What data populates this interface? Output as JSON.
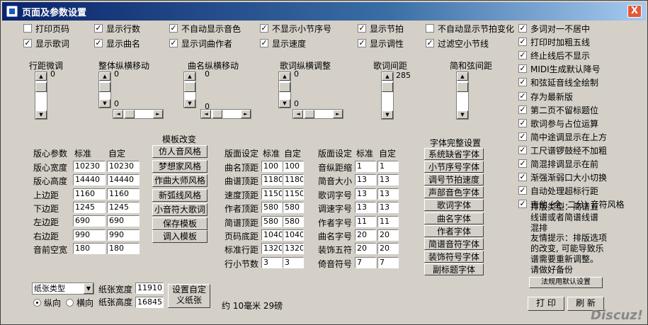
{
  "window": {
    "title": "页面及参数设置",
    "close": "X"
  },
  "row1": [
    "打印页码",
    "显示行数",
    "不自动显示音色",
    "不显示小节序号",
    "显示节拍",
    "不自动显示节拍变化"
  ],
  "row1_checked": [
    false,
    true,
    true,
    true,
    true,
    false
  ],
  "row2": [
    "显示歌词",
    "显示曲名",
    "显示词曲作者",
    "显示速度",
    "显示调性",
    "过滤空小节线"
  ],
  "row2_checked": [
    true,
    true,
    true,
    true,
    true,
    true
  ],
  "right_options": [
    "多词对一不居中",
    "打印时加粗五线",
    "终止线后不显示",
    "MIDI生成默认降号",
    "和弦延音线全绘制",
    "存为最新版",
    "第二页不留标题位",
    "歌词参与占位运算",
    "简中途调显示在上方",
    "工尺谱锣鼓经不加粗",
    "简混排调显示在前",
    "渐强渐弱口大小切换",
    "自动处理超标行距",
    "吉他 (全, 二分) 音符风格"
  ],
  "right_checked": [
    true,
    true,
    true,
    true,
    true,
    true,
    true,
    true,
    true,
    true,
    true,
    true,
    true,
    true
  ],
  "sliders": {
    "line_spacing": "行距微调",
    "overall": "整体纵横移动",
    "title_move": "曲名纵横移动",
    "lyric_adjust": "歌词纵横调整",
    "lyric_spacing": "歌词间距",
    "chord_spacing": "简和弦间距"
  },
  "slider_vals": {
    "v1": "0",
    "v2a": "0",
    "v2b": "0",
    "v3a": "0",
    "v3b": "0",
    "v4a": "0",
    "v4b": "0",
    "v5": "285"
  },
  "layout_table": {
    "header": [
      "版心参数",
      "标准",
      "自定"
    ],
    "rows": [
      [
        "版心宽度",
        "10230",
        "10230"
      ],
      [
        "版心高度",
        "14440",
        "14440"
      ],
      [
        "上边距",
        "1160",
        "1160"
      ],
      [
        "下边距",
        "1245",
        "1245"
      ],
      [
        "左边距",
        "690",
        "690"
      ],
      [
        "右边距",
        "990",
        "990"
      ],
      [
        "音前空宽",
        "180",
        "180"
      ]
    ]
  },
  "templates": {
    "title": "模板改变",
    "buttons": [
      "仿人音风格",
      "梦想家风格",
      "作曲大师风格",
      "新弧线风格",
      "小音符大歌词",
      "保存模板",
      "调入模板"
    ]
  },
  "page_table": {
    "header": [
      "版面设定",
      "标准",
      "自定"
    ],
    "rows": [
      [
        "曲名顶距",
        "100",
        "100"
      ],
      [
        "曲谱顶距",
        "1180",
        "1180"
      ],
      [
        "速度顶距",
        "1150",
        "1150"
      ],
      [
        "作者顶距",
        "580",
        "580"
      ],
      [
        "简谱顶距",
        "580",
        "580"
      ],
      [
        "页码底距",
        "1040",
        "1040"
      ],
      [
        "标准行距",
        "1320",
        "1320"
      ],
      [
        "行小节数",
        "3",
        "3"
      ]
    ]
  },
  "page_table2": {
    "header": [
      "版面设定",
      "标准",
      "自定"
    ],
    "rows": [
      [
        "音纵距缩",
        "1",
        "1"
      ],
      [
        "简音大小",
        "13",
        "13"
      ],
      [
        "歌词字号",
        "13",
        "13"
      ],
      [
        "调速字号",
        "13",
        "13"
      ],
      [
        "作者字号",
        "11",
        "11"
      ],
      [
        "曲名字号",
        "20",
        "20"
      ],
      [
        "装饰五符",
        "20",
        "20"
      ],
      [
        "倚音符号",
        "7",
        "7"
      ]
    ]
  },
  "fonts": {
    "title": "字体完整设置",
    "buttons": [
      "系统缺省字体",
      "小节序号字体",
      "调号节拍速度",
      "声部音色字体",
      "歌词字体",
      "曲名字体",
      "作者字体",
      "简谱音符字体",
      "装饰符号字体",
      "副标题字体"
    ]
  },
  "paper": {
    "type": "纸张类型",
    "width_label": "纸张宽度",
    "width": "11910",
    "height_label": "纸张高度",
    "height": "16845",
    "portrait": "纵向",
    "landscape": "横向",
    "custom_btn": "设置自定\n义纸张",
    "approx": "约 10毫米 29磅"
  },
  "typeset_note": "排版类型：简谱五\n线谱或者简谱线谱\n混排",
  "tip": "友情提示：排版选项\n的改变, 可能导致乐\n谱需要重新调整。\n请做好备份",
  "bottom": {
    "reset": "法规用默认设置",
    "print": "打 印",
    "refresh": "刷 新"
  },
  "watermark": "Discuz!"
}
